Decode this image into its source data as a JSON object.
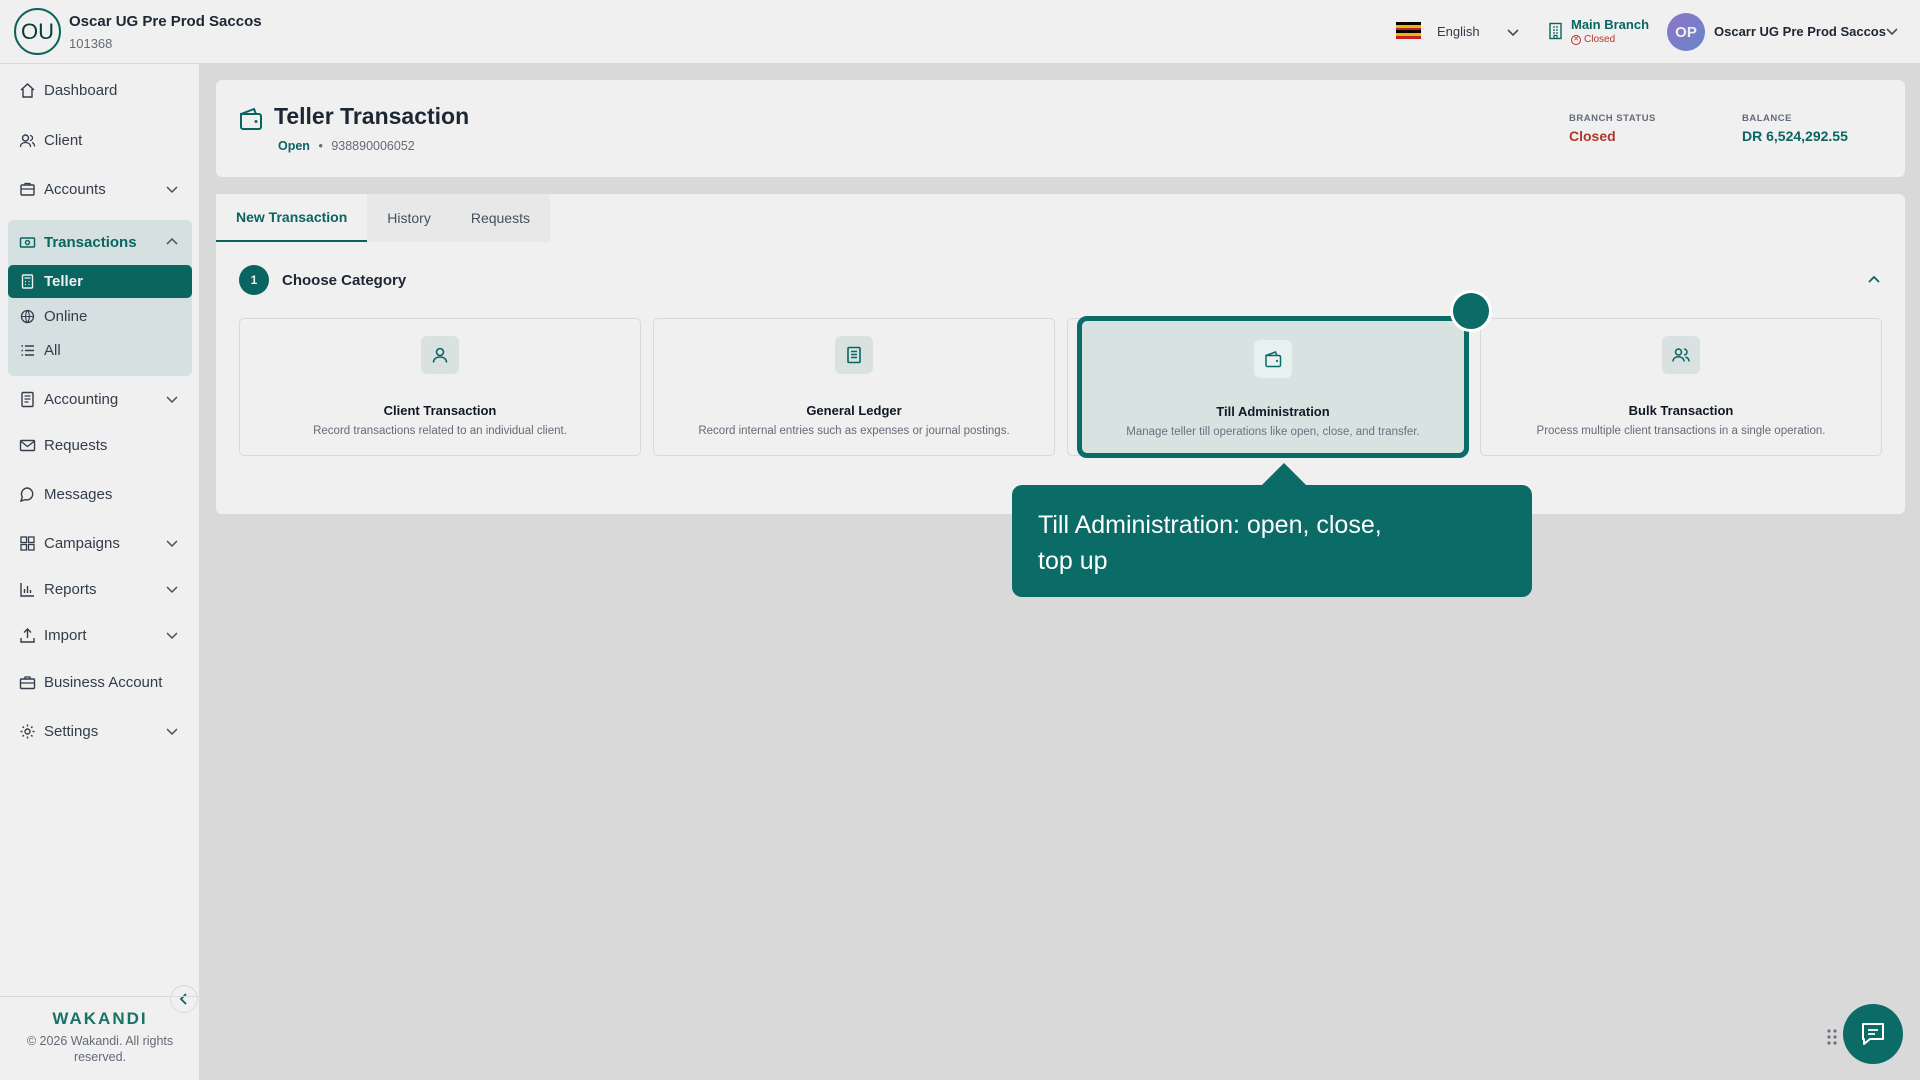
{
  "org": {
    "logo_initials": "OU",
    "name": "Oscar UG Pre Prod Saccos",
    "id": "101368"
  },
  "topbar": {
    "language": "English",
    "branch_name": "Main Branch",
    "branch_status": "Closed",
    "user_initials": "OP",
    "user_name": "Oscarr UG Pre Prod Saccos"
  },
  "sidebar": {
    "items": [
      {
        "label": "Dashboard"
      },
      {
        "label": "Client"
      },
      {
        "label": "Accounts"
      },
      {
        "label": "Transactions"
      },
      {
        "label": "Accounting"
      },
      {
        "label": "Requests"
      },
      {
        "label": "Messages"
      },
      {
        "label": "Campaigns"
      },
      {
        "label": "Reports"
      },
      {
        "label": "Import"
      },
      {
        "label": "Business Account"
      },
      {
        "label": "Settings"
      }
    ],
    "transactions_sub": [
      {
        "label": "Teller"
      },
      {
        "label": "Online"
      },
      {
        "label": "All"
      }
    ],
    "brand": "WAKANDI",
    "copyright": "© 2026 Wakandi. All rights reserved."
  },
  "header": {
    "title": "Teller Transaction",
    "status": "Open",
    "separator": "•",
    "account_no": "938890006052",
    "branch_status_label": "BRANCH STATUS",
    "branch_status_value": "Closed",
    "balance_label": "BALANCE",
    "balance_value": "DR 6,524,292.55"
  },
  "tabs": [
    {
      "label": "New Transaction"
    },
    {
      "label": "History"
    },
    {
      "label": "Requests"
    }
  ],
  "step": {
    "number": "1",
    "title": "Choose Category"
  },
  "categories": [
    {
      "title": "Client Transaction",
      "desc": "Record transactions related to an individual client.",
      "icon": "user-icon"
    },
    {
      "title": "General Ledger",
      "desc": "Record internal entries such as expenses or journal postings.",
      "icon": "ledger-icon"
    },
    {
      "title": "Till Administration",
      "desc": "Manage teller till operations like open, close, and transfer.",
      "icon": "wallet-icon"
    },
    {
      "title": "Bulk Transaction",
      "desc": "Process multiple client transactions in a single operation.",
      "icon": "users-icon"
    }
  ],
  "tooltip": {
    "text": "Till Administration: open, close, top up"
  },
  "colors": {
    "primary": "#0b6b66",
    "danger": "#c0392b",
    "background": "#e8e7e7"
  }
}
